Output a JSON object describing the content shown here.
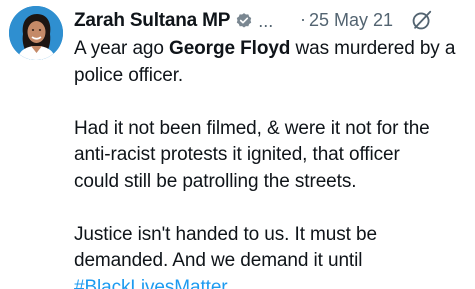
{
  "author": {
    "name": "Zarah Sultana MP",
    "handle_truncated": "...",
    "avatar_icon": "profile-photo",
    "verified_icon": "verified-badge-icon"
  },
  "meta": {
    "separator": "·",
    "date": "25 May 21",
    "mute_icon": "mute-conversation-icon"
  },
  "tweet": {
    "p1_pre": "A year ago ",
    "p1_bold": "George Floyd",
    "p1_post_line1": " was murdered by a",
    "p1_line2": "police officer.",
    "p2_line1": "Had it not been filmed, & were it not for the",
    "p2_line2": "anti-racist protests it ignited, that officer",
    "p2_line3": "could still be patrolling the streets.",
    "p3_line1": "Justice isn't handed to us. It must be",
    "p3_line2": "demanded. And we demand it until",
    "hashtag": "#BlackLivesMatter"
  },
  "colors": {
    "text": "#0f1419",
    "secondary": "#536471",
    "link": "#1d9bf0",
    "avatar_bg": "#2f8fd0"
  }
}
